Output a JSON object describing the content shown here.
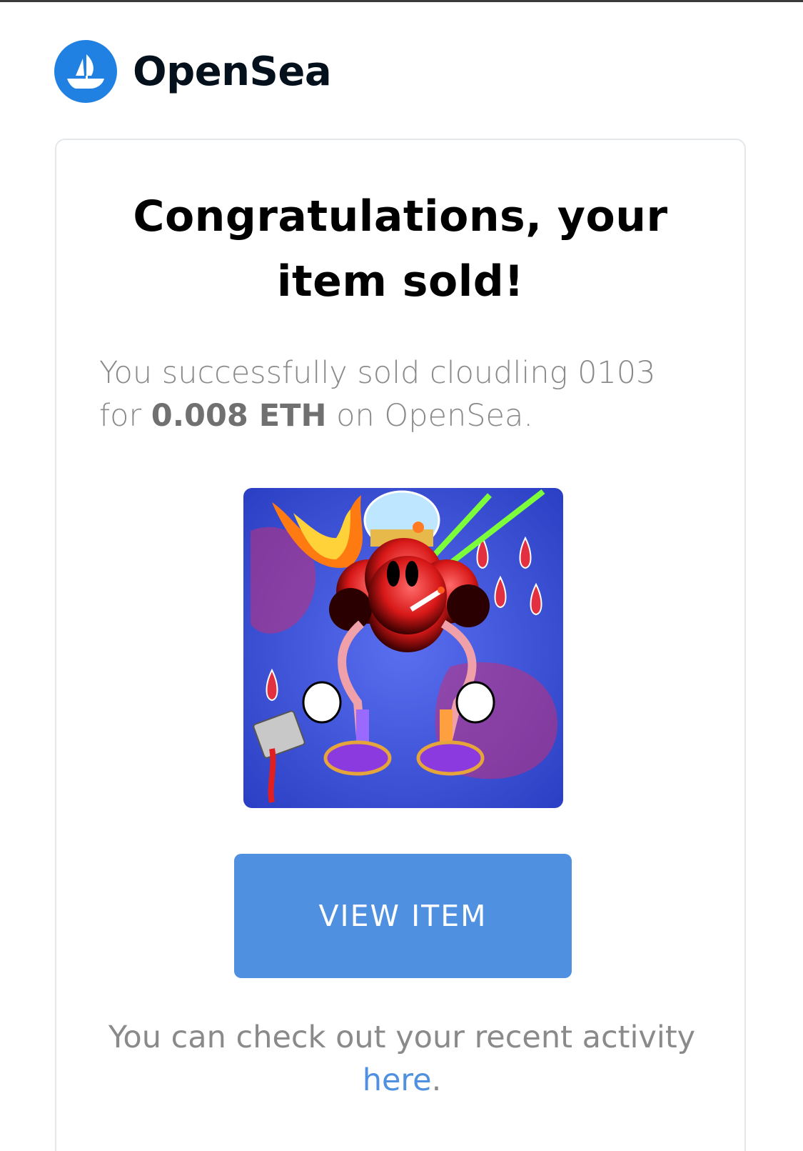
{
  "brand": {
    "name": "OpenSea",
    "logo_icon": "opensea-ship-logo-icon",
    "logo_color": "#2081e2"
  },
  "card": {
    "headline_line1": "Congratulations, your",
    "headline_line2": "item sold!",
    "message_prefix": "You successfully sold cloudling 0103 for",
    "price": "0.008 ETH",
    "message_suffix": "on OpenSea.",
    "nft_image": "cloudling-0103-artwork",
    "view_button_label": "VIEW ITEM",
    "view_button_color": "#4f90e0",
    "footer_prefix": "You can check out your recent activity",
    "footer_link": "here",
    "footer_suffix": "."
  }
}
